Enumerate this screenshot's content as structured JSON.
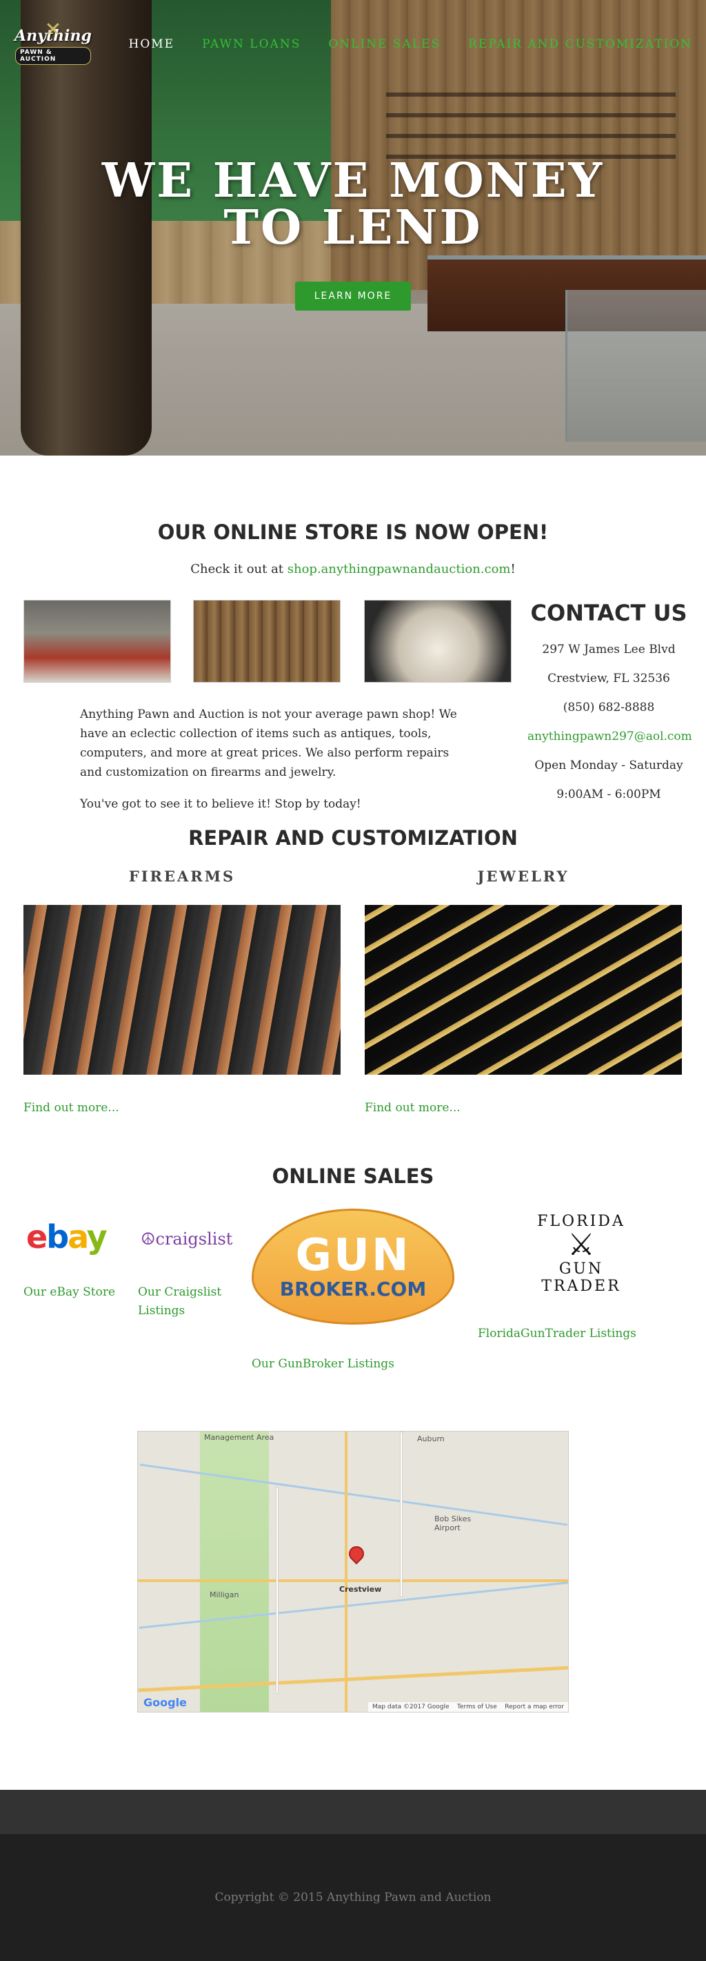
{
  "brand": {
    "logo_text": "Anything",
    "logo_sub": "PAWN & AUCTION"
  },
  "nav": {
    "items": [
      {
        "label": "HOME",
        "active": true
      },
      {
        "label": "PAWN LOANS",
        "active": false
      },
      {
        "label": "ONLINE SALES",
        "active": false
      },
      {
        "label": "REPAIR AND CUSTOMIZATION",
        "active": false
      }
    ]
  },
  "hero": {
    "title": "WE HAVE MONEY TO LEND",
    "button_label": "LEARN MORE"
  },
  "store": {
    "title": "OUR ONLINE STORE IS NOW OPEN!",
    "prefix": "Check it out at ",
    "link": "shop.anythingpawnandauction.com",
    "suffix": "!"
  },
  "intro": {
    "paragraph1": "Anything Pawn and Auction is not your average pawn shop! We have an eclectic collection of items such as antiques, tools, computers, and more at great prices. We also perform repairs and customization on firearms and jewelry.",
    "paragraph2": "You've got to see it to believe it! Stop by today!"
  },
  "contact": {
    "title": "CONTACT US",
    "address1": "297 W James Lee Blvd",
    "address2": "Crestview, FL 32536",
    "phone": "(850) 682-8888",
    "email": "anythingpawn297@aol.com",
    "days": "Open Monday - Saturday",
    "hours": "9:00AM - 6:00PM"
  },
  "repair": {
    "title": "REPAIR AND CUSTOMIZATION",
    "left_title": "FIREARMS",
    "right_title": "JEWELRY",
    "left_link": "Find out more...",
    "right_link": "Find out more..."
  },
  "online": {
    "title": "ONLINE SALES",
    "ebay_logo": "ebay",
    "craigslist_logo": "craigslist",
    "gunbroker_logo_1": "GUN",
    "gunbroker_logo_2": "BROKER.COM",
    "fl_logo_1": "FLORIDA",
    "fl_logo_2": "GUN",
    "fl_logo_3": "TRADER",
    "ebay_link": "Our eBay Store",
    "craigslist_link": "Our Craigslist Listings",
    "gunbroker_link": "Our GunBroker Listings",
    "fl_link": "FloridaGunTrader Listings"
  },
  "map": {
    "labels": {
      "auburn": "Auburn",
      "airport": "Bob Sikes Airport",
      "milligan": "Milligan",
      "crestview": "Crestview",
      "management": "Management Area"
    },
    "google": "Google",
    "footer_data": "Map data ©2017 Google",
    "footer_terms": "Terms of Use",
    "footer_report": "Report a map error"
  },
  "footer": {
    "copyright": "Copyright © 2015 Anything Pawn and Auction"
  },
  "colors": {
    "accent": "#2e9a2e",
    "footer_dark": "#202020",
    "footer_mid": "#333333"
  }
}
